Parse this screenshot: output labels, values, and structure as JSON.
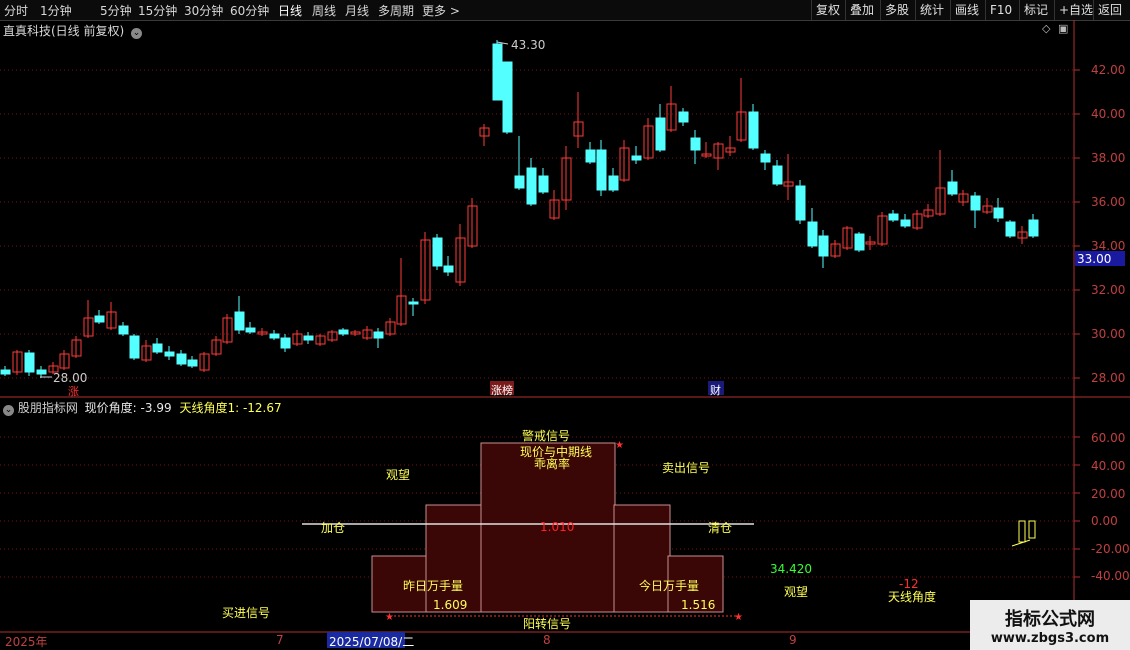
{
  "toolbar": {
    "periods": [
      "分时",
      "1分钟",
      "5分钟",
      "15分钟",
      "30分钟",
      "60分钟",
      "日线",
      "周线",
      "月线",
      "多周期",
      "更多 >"
    ],
    "active_period": "日线",
    "right_buttons": [
      "复权",
      "叠加",
      "多股",
      "统计",
      "画线",
      "F10",
      "标记",
      "+自选",
      "返回"
    ]
  },
  "main_chart": {
    "title": "直真科技(日线 前复权)",
    "high_label": "43.30",
    "low_label": "28.00",
    "price_ticks": [
      "42.00",
      "40.00",
      "38.00",
      "36.00",
      "34.00",
      "32.00",
      "30.00",
      "28.00"
    ],
    "current_price": "33.00",
    "markers": [
      {
        "text": "涨",
        "color": "#ff3030"
      },
      {
        "text": "涨榜",
        "color": "#ffffff"
      },
      {
        "text": "财",
        "color": "#ffffff"
      }
    ]
  },
  "indicator": {
    "name": "股朋指标网",
    "field1_label": "现价角度:",
    "field1_value": "-3.99",
    "field2_label": "天线角度1:",
    "field2_value": "-12.67",
    "ticks": [
      "60.00",
      "40.00",
      "20.00",
      "0.00",
      "-20.00",
      "-40.00"
    ],
    "texts": {
      "warning": "警戒信号",
      "deviation_line1": "现价与中期线",
      "deviation_line2": "乖离率",
      "watch": "观望",
      "sell": "卖出信号",
      "add": "加仓",
      "clear": "清仓",
      "center_value": "1.010",
      "yesterday_vol": "昨日万手量",
      "yesterday_val": "1.609",
      "today_vol": "今日万手量",
      "today_val": "1.516",
      "buy": "买进信号",
      "yang": "阳转信号",
      "value_34": "34.420",
      "watch2": "观望",
      "neg12": "-12",
      "sky_angle": "天线角度"
    }
  },
  "time_axis": {
    "labels": [
      "2025年",
      "7",
      "2025/07/08/二",
      "8",
      "9"
    ]
  },
  "watermark": {
    "line1": "指标公式网",
    "line2": "www.zbgs3.com"
  },
  "colors": {
    "up": "#ff3b3b",
    "down": "#54ffff",
    "axis": "#b03030",
    "yellow": "#ffff55"
  }
}
